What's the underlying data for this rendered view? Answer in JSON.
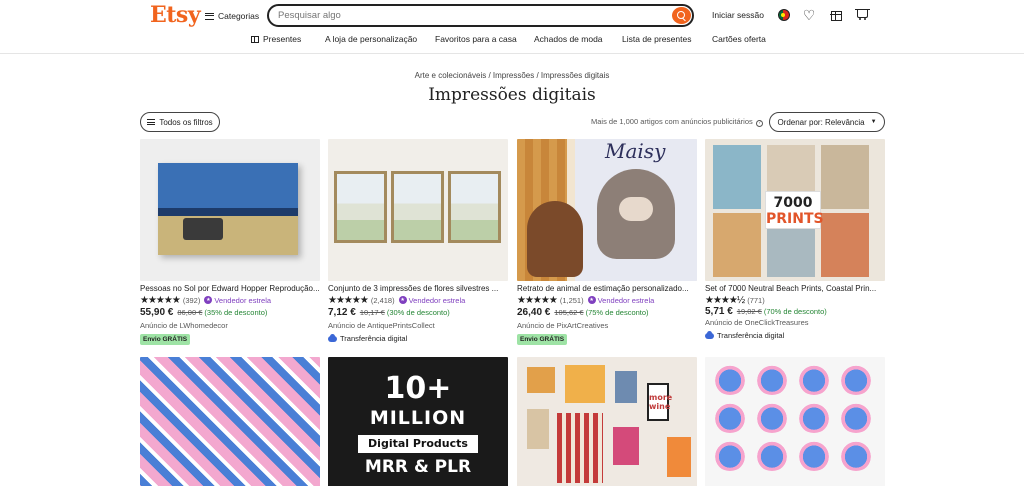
{
  "header": {
    "logo": "Etsy",
    "categories_label": "Categorias",
    "search_placeholder": "Pesquisar algo",
    "signin_label": "Iniciar sessão"
  },
  "nav": {
    "items": [
      "Presentes",
      "A loja de personalização",
      "Favoritos para a casa",
      "Achados de moda",
      "Lista de presentes",
      "Cartões oferta"
    ]
  },
  "breadcrumb": "Arte e colecionáveis / Impressões / Impressões digitais",
  "page_title": "Impressões digitais",
  "toolbar": {
    "filters_label": "Todos os filtros",
    "results_text": "Mais de 1,000 artigos com anúncios publicitários",
    "sort_prefix": "Ordenar por:",
    "sort_value": "Relevância"
  },
  "products": [
    {
      "title": "Pessoas no Sol por Edward Hopper Reprodução...",
      "stars": "★★★★★",
      "rating_count": "(392)",
      "star_seller": "Vendedor estrela",
      "price": "55,90 €",
      "old_price": "86,00 €",
      "discount": "(35% de desconto)",
      "seller": "Anúncio de LWhomedecor",
      "badge": "Envio GRÁTIS"
    },
    {
      "title": "Conjunto de 3 impressões de flores silvestres ...",
      "stars": "★★★★★",
      "rating_count": "(2,418)",
      "star_seller": "Vendedor estrela",
      "price": "7,12 €",
      "old_price": "10,17 €",
      "discount": "(30% de desconto)",
      "seller": "Anúncio de AntiquePrintsCollect",
      "badge": "Transferência digital"
    },
    {
      "title": "Retrato de animal de estimação personalizado...",
      "stars": "★★★★★",
      "rating_count": "(1,251)",
      "star_seller": "Vendedor estrela",
      "price": "26,40 €",
      "old_price": "105,62 €",
      "discount": "(75% de desconto)",
      "seller": "Anúncio de PixArtCreatives",
      "badge": "Envio GRÁTIS",
      "poster_text": "Maisy"
    },
    {
      "title": "Set of 7000 Neutral Beach Prints, Coastal Prin...",
      "stars": "★★★★½",
      "rating_count": "(771)",
      "price": "5,71 €",
      "old_price": "19,02 €",
      "discount": "(70% de desconto)",
      "seller": "Anúncio de OneClickTreasures",
      "badge": "Transferência digital",
      "image_text_1": "7000",
      "image_text_2": "PRINTS"
    }
  ],
  "second_row": {
    "digital_products_image": {
      "line1": "10+",
      "line2": "MILLION",
      "line3": "Digital Products",
      "line4": "MRR & PLR"
    },
    "gallery_wall_text": "more wine"
  },
  "colors": {
    "brand": "#f1641e",
    "star_seller": "#7f3fbf",
    "discount": "#258635",
    "free_shipping_badge": "#9ee3a5"
  }
}
